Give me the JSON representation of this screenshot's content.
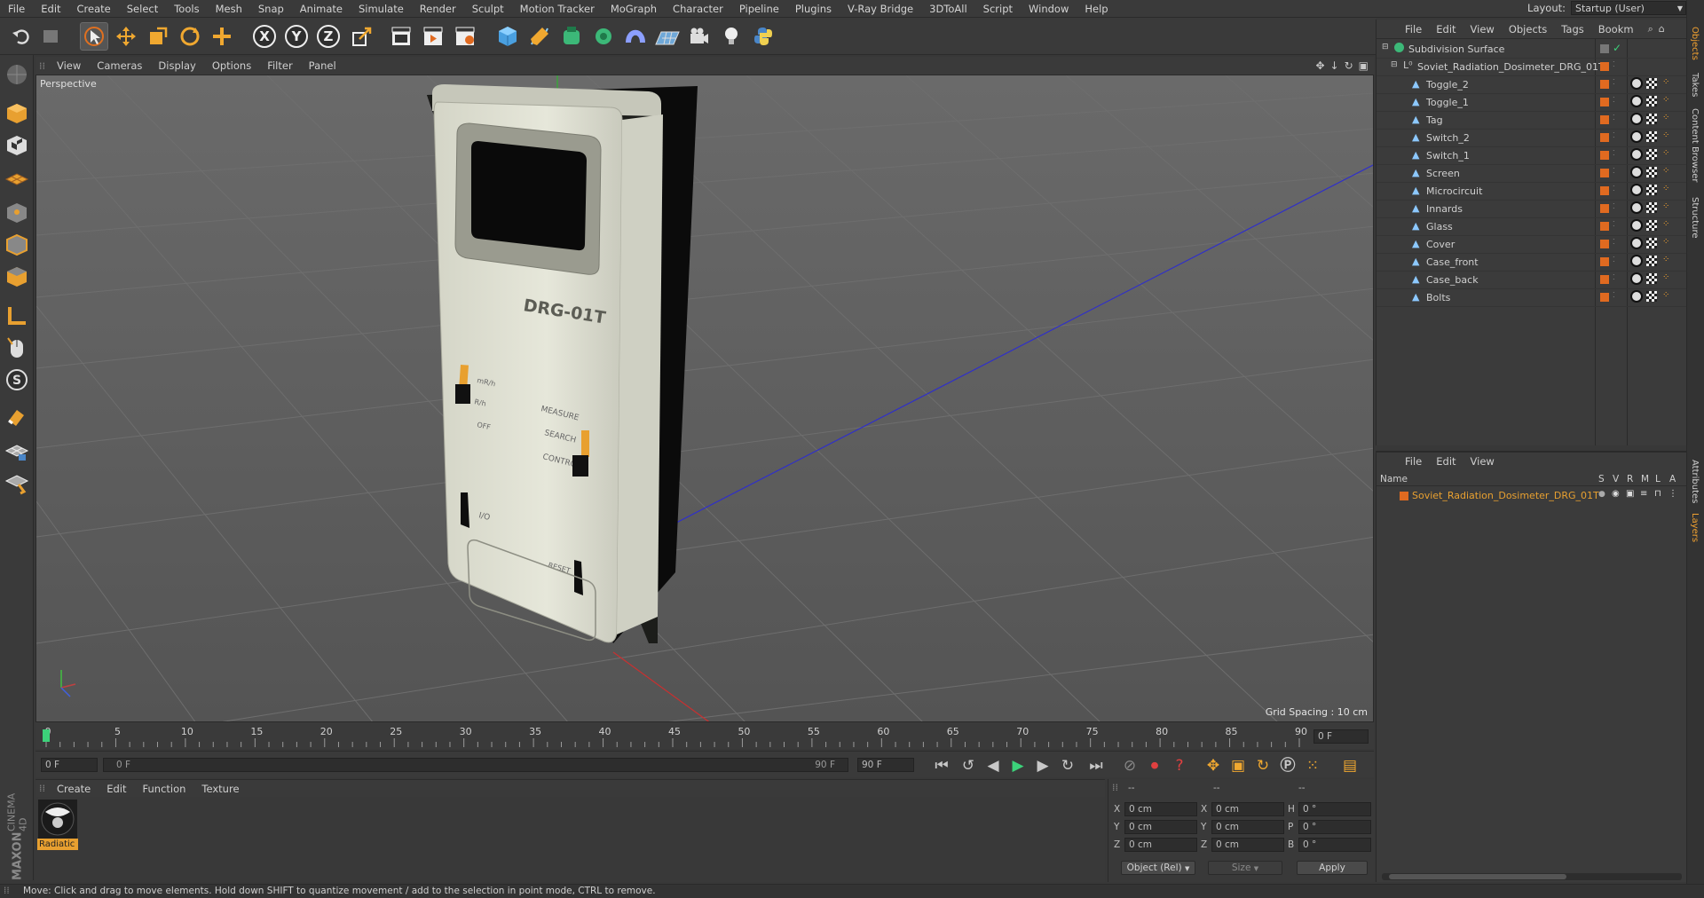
{
  "menubar": {
    "items": [
      "File",
      "Edit",
      "Create",
      "Select",
      "Tools",
      "Mesh",
      "Snap",
      "Animate",
      "Simulate",
      "Render",
      "Sculpt",
      "Motion Tracker",
      "MoGraph",
      "Character",
      "Pipeline",
      "Plugins",
      "V-Ray Bridge",
      "3DToAll",
      "Script",
      "Window",
      "Help"
    ],
    "layout_label": "Layout:",
    "layout_value": "Startup (User)"
  },
  "toolbar": {
    "axis_x": "X",
    "axis_y": "Y",
    "axis_z": "Z"
  },
  "viewport": {
    "menu": [
      "View",
      "Cameras",
      "Display",
      "Options",
      "Filter",
      "Panel"
    ],
    "camera_label": "Perspective",
    "grid_spacing": "Grid Spacing : 10 cm",
    "model_text": {
      "model_name": "DRG-01T",
      "switch_left": [
        "mR/h",
        "R/h",
        "OFF"
      ],
      "switch_right": [
        "MEASURE",
        "SEARCH",
        "CONTROL"
      ],
      "io_label": "I/O",
      "reset_label": "RESET"
    }
  },
  "timeline": {
    "ticks": [
      "0",
      "5",
      "10",
      "15",
      "20",
      "25",
      "30",
      "35",
      "40",
      "45",
      "50",
      "55",
      "60",
      "65",
      "70",
      "75",
      "80",
      "85",
      "90"
    ],
    "current_frame": "0 F"
  },
  "anim_bar": {
    "start_field": "0 F",
    "range_start": "0 F",
    "range_end": "90 F",
    "end_field": "90 F"
  },
  "material_manager": {
    "menu": [
      "Create",
      "Edit",
      "Function",
      "Texture"
    ],
    "material_name": "Radiatic"
  },
  "coordinates": {
    "header_left": "--",
    "header_mid": "--",
    "header_right": "--",
    "rows": [
      {
        "a": "X",
        "a_val": "0 cm",
        "b": "X",
        "b_val": "0 cm",
        "c": "H",
        "c_val": "0 °"
      },
      {
        "a": "Y",
        "a_val": "0 cm",
        "b": "Y",
        "b_val": "0 cm",
        "c": "P",
        "c_val": "0 °"
      },
      {
        "a": "Z",
        "a_val": "0 cm",
        "b": "Z",
        "b_val": "0 cm",
        "c": "B",
        "c_val": "0 °"
      }
    ],
    "mode_select": "Object (Rel)",
    "size_select": "Size",
    "apply_button": "Apply"
  },
  "logo": {
    "line1": "MAXON",
    "line2": "CINEMA 4D"
  },
  "status": "Move: Click and drag to move elements. Hold down SHIFT to quantize movement / add to the selection in point mode, CTRL to remove.",
  "object_manager": {
    "menu": [
      "File",
      "Edit",
      "View",
      "Objects",
      "Tags",
      "Bookm"
    ],
    "root": "Subdivision Surface",
    "group": "Soviet_Radiation_Dosimeter_DRG_01T",
    "children": [
      "Toggle_2",
      "Toggle_1",
      "Tag",
      "Switch_2",
      "Switch_1",
      "Screen",
      "Microcircuit",
      "Innards",
      "Glass",
      "Cover",
      "Case_front",
      "Case_back",
      "Bolts"
    ]
  },
  "layer_manager": {
    "menu": [
      "File",
      "Edit",
      "View"
    ],
    "header_name": "Name",
    "header_cols": [
      "S",
      "V",
      "R",
      "M",
      "L",
      "A"
    ],
    "layer_name": "Soviet_Radiation_Dosimeter_DRG_01T"
  },
  "right_tabs": [
    "Objects",
    "Takes",
    "Content Browser",
    "Structure",
    "Attributes",
    "Layers"
  ],
  "colors": {
    "accent_orange": "#e8a030",
    "layer_orange": "#e06a20",
    "viewport_bg": "#5b5b5b",
    "device_body": "#dfe0d2"
  }
}
